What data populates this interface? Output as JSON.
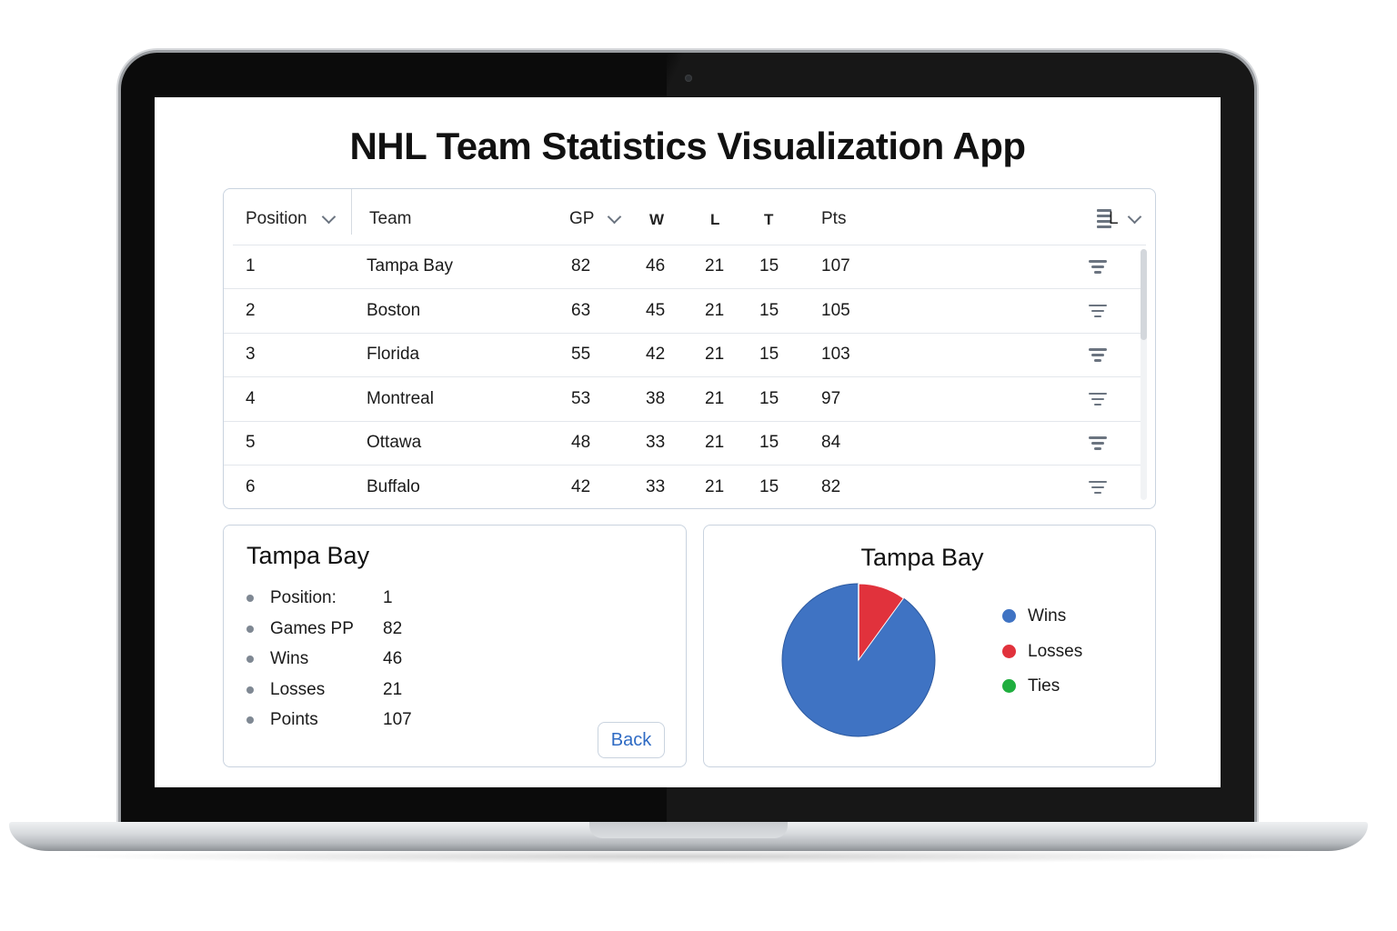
{
  "app": {
    "title": "NHL Team Statistics Visualization App"
  },
  "table": {
    "columns": {
      "position": "Position",
      "team": "Team",
      "gp": "GP",
      "w": "W",
      "l": "L",
      "t": "T",
      "pts": "Pts",
      "list_menu": "L"
    },
    "rows": [
      {
        "position": "1",
        "team": "Tampa Bay",
        "gp": "82",
        "w": "46",
        "l": "21",
        "t": "15",
        "pts": "107"
      },
      {
        "position": "2",
        "team": "Boston",
        "gp": "63",
        "w": "45",
        "l": "21",
        "t": "15",
        "pts": "105"
      },
      {
        "position": "3",
        "team": "Florida",
        "gp": "55",
        "w": "42",
        "l": "21",
        "t": "15",
        "pts": "103"
      },
      {
        "position": "4",
        "team": "Montreal",
        "gp": "53",
        "w": "38",
        "l": "21",
        "t": "15",
        "pts": "97"
      },
      {
        "position": "5",
        "team": "Ottawa",
        "gp": "48",
        "w": "33",
        "l": "21",
        "t": "15",
        "pts": "84"
      },
      {
        "position": "6",
        "team": "Buffalo",
        "gp": "42",
        "w": "33",
        "l": "21",
        "t": "15",
        "pts": "82"
      }
    ],
    "row_icon": "filter-icon",
    "header_icons": [
      "chevron-down-icon",
      "list-icon"
    ]
  },
  "detail": {
    "title": "Tampa Bay",
    "items": [
      {
        "label": "Position:",
        "value": "1"
      },
      {
        "label": "Games PP",
        "value": "82"
      },
      {
        "label": "Wins",
        "value": "46"
      },
      {
        "label": "Losses",
        "value": "21"
      },
      {
        "label": "Points",
        "value": "107"
      }
    ],
    "back_label": "Back"
  },
  "chart_data": {
    "type": "pie",
    "title": "Tampa Bay",
    "categories": [
      "Wins",
      "Losses",
      "Ties"
    ],
    "values": [
      0.9,
      0.1,
      0.0
    ],
    "colors": [
      "#3f73c3",
      "#e1323c",
      "#1fae3e"
    ],
    "legend_position": "right"
  },
  "colors": {
    "accent": "#2f6bc4",
    "border": "#c9d3df",
    "icon_gray": "#6b7480"
  }
}
